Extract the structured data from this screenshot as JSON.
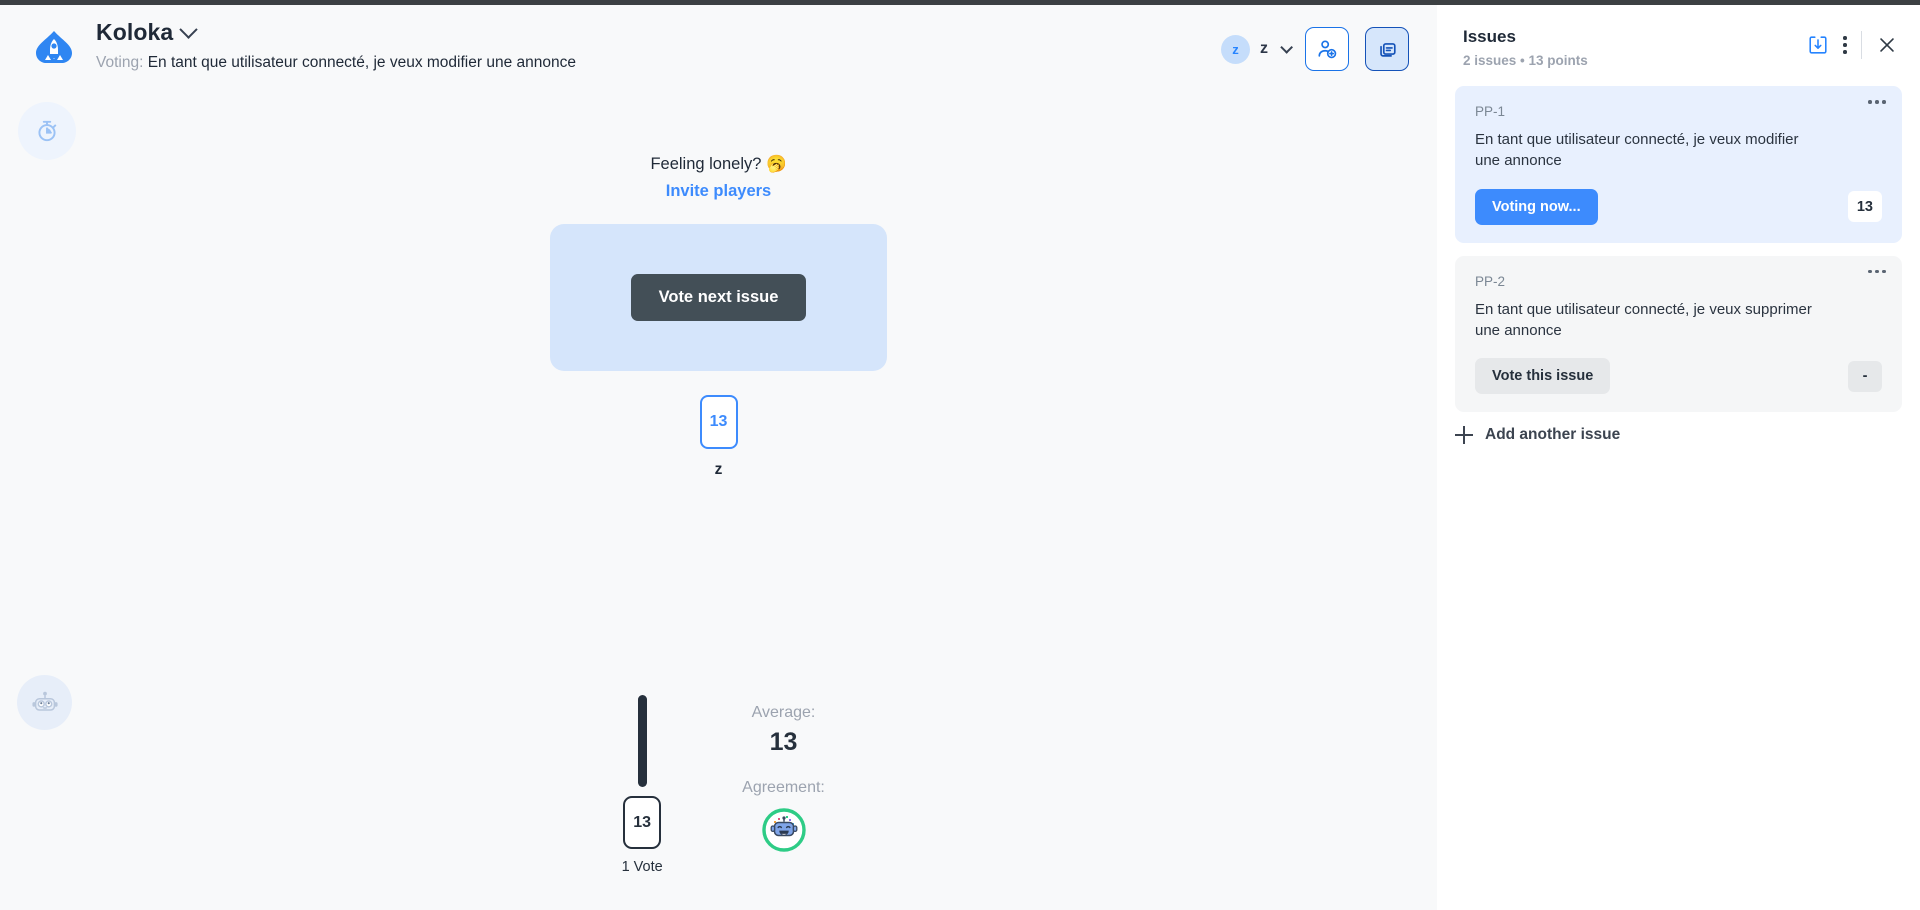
{
  "app": {
    "logo_icon": "rocket-spade-logo",
    "room_name": "Koloka",
    "room_dropdown_icon": "chevron-down-icon",
    "status_label": "Voting:",
    "status_issue": "En tant que utilisateur connecté, je veux modifier une annonce"
  },
  "header": {
    "user": {
      "avatar_initial": "z",
      "name": "z",
      "dropdown_icon": "chevron-down-icon"
    },
    "invite_button_icon": "add-person-icon",
    "cards_button_icon": "cards-stack-icon"
  },
  "side_rail": {
    "timer_icon": "stopwatch-icon",
    "bot_icon": "robot-icon"
  },
  "main": {
    "lonely_text": "Feeling lonely? 🥱",
    "invite_link": "Invite players",
    "vote_next_button": "Vote next issue",
    "player": {
      "card_value": "13",
      "name": "z"
    }
  },
  "results": {
    "tally": {
      "card_value": "13",
      "vote_count_label": "1 Vote"
    },
    "average_label": "Average:",
    "average_value": "13",
    "agreement_label": "Agreement:",
    "agreement_icon": "robot-party-icon"
  },
  "panel": {
    "title": "Issues",
    "subtitle": "2 issues • 13 points",
    "import_icon": "import-issues-icon",
    "more_icon": "kebab-menu-icon",
    "close_icon": "close-icon",
    "add_issue_label": "Add another issue",
    "add_issue_icon": "plus-icon",
    "issues": [
      {
        "key": "PP-1",
        "text": "En tant que utilisateur connecté, je veux modifier une annonce",
        "action_label": "Voting now...",
        "points": "13",
        "selected": true
      },
      {
        "key": "PP-2",
        "text": "En tant que utilisateur connecté, je veux supprimer une annonce",
        "action_label": "Vote this issue",
        "points": "-",
        "selected": false
      }
    ]
  },
  "colors": {
    "accent_blue": "#3d8bfd",
    "brand_blue": "#2684ff",
    "panel_selected": "#e8f0fe",
    "dark_button": "#434f57",
    "agreement_green": "#2ecc86"
  }
}
